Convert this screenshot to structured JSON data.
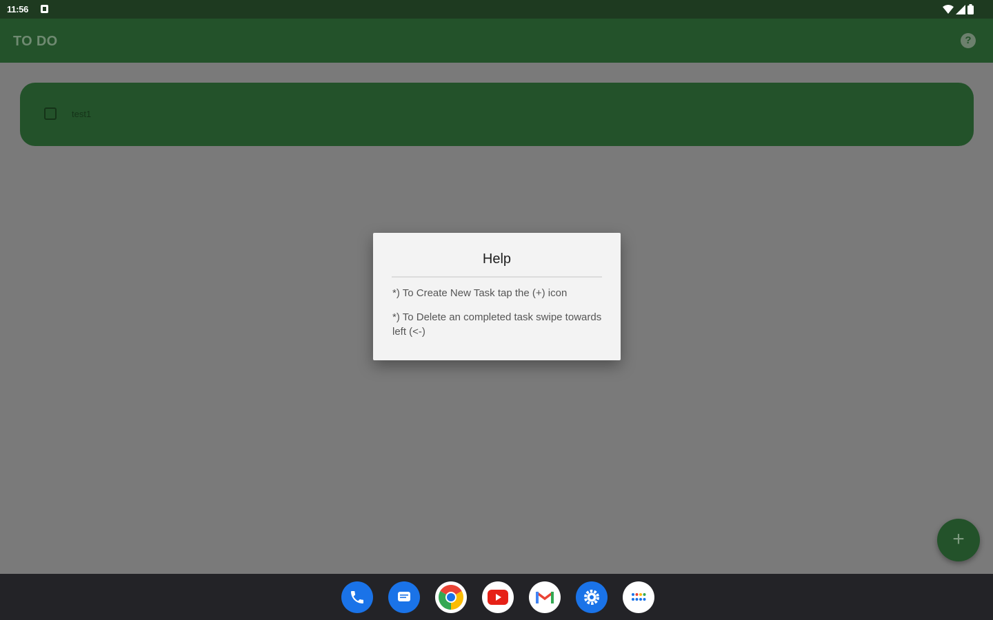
{
  "status_bar": {
    "time": "11:56"
  },
  "app_bar": {
    "title": "TO DO",
    "help_icon_glyph": "?"
  },
  "tasks": [
    {
      "label": "test1",
      "checked": false
    }
  ],
  "dialog": {
    "title": "Help",
    "line1": "*) To Create New Task tap the (+) icon",
    "line2": "*) To Delete an completed task swipe towards left (<-)"
  },
  "fab": {
    "glyph": "+"
  },
  "colors": {
    "primary": "#23522a",
    "status_bar": "#1e3a20",
    "scrim_background": "#7a7a7a",
    "dialog_background": "#f3f3f3",
    "nav_bar": "#232327"
  },
  "dock_apps": [
    "phone-icon",
    "messages-icon",
    "chrome-icon",
    "youtube-icon",
    "gmail-icon",
    "settings-icon",
    "app-drawer-icon"
  ]
}
